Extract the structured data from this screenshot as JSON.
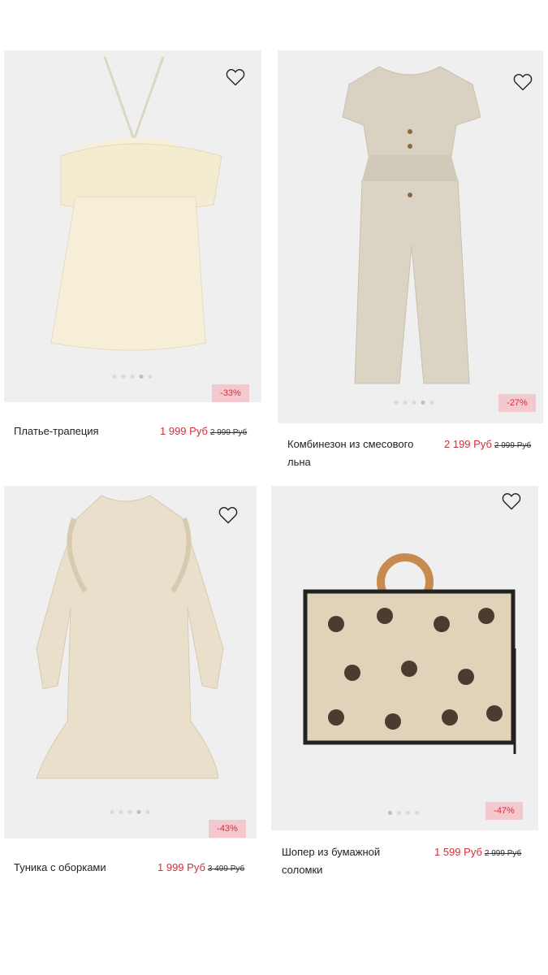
{
  "products": [
    {
      "title": "Платье-трапеция",
      "price": "1 999 Руб",
      "old_price": "2 999 Руб",
      "discount": "-33%",
      "image": "cream-ruffle-dress",
      "icon": "heart-icon",
      "dots_total": 5,
      "dots_active": 4
    },
    {
      "title": "Комбинезон из смесового льна",
      "price": "2 199 Руб",
      "old_price": "2 999 Руб",
      "discount": "-27%",
      "image": "linen-jumpsuit",
      "icon": "heart-icon",
      "dots_total": 5,
      "dots_active": 4
    },
    {
      "title": "Туника с оборками",
      "price": "1 999 Руб",
      "old_price": "3 499 Руб",
      "discount": "-43%",
      "image": "ruffle-tunic-dress",
      "icon": "heart-icon",
      "dots_total": 5,
      "dots_active": 4
    },
    {
      "title": "Шопер из бумажной соломки",
      "price": "1 599 Руб",
      "old_price": "2 999 Руб",
      "discount": "-47%",
      "image": "leopard-straw-bag",
      "icon": "heart-icon",
      "dots_total": 4,
      "dots_active": 1
    }
  ],
  "colors": {
    "photo_bg": "#efefef",
    "discount_bg": "#f3c9cf",
    "accent": "#d22f3a"
  }
}
